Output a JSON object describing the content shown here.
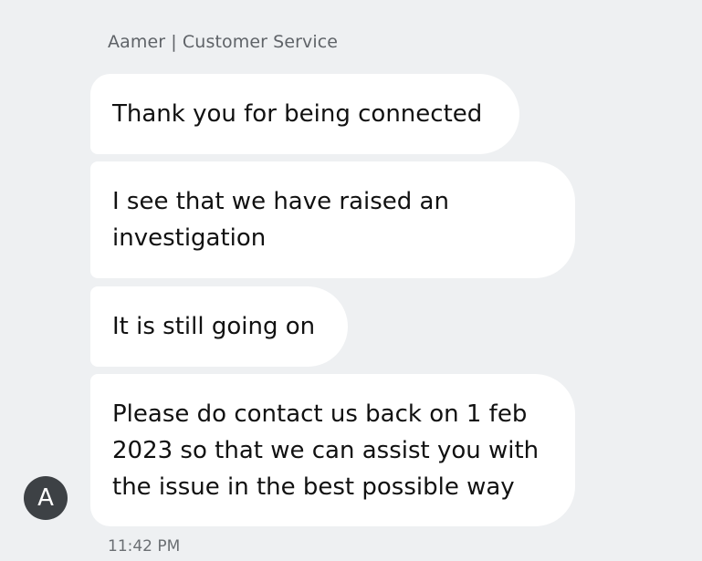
{
  "header": {
    "sender": "Aamer | Customer Service"
  },
  "messages": [
    {
      "text": "Thank you for being connected"
    },
    {
      "text": "I see that we have raised an\ninvestigation"
    },
    {
      "text": "It is still going on"
    },
    {
      "text": "Please do contact us back on 1 feb\n2023 so that we can assist you with\nthe issue in the best possible way"
    }
  ],
  "avatar": {
    "initial": "A"
  },
  "footer": {
    "timestamp": "11:42 PM"
  },
  "colors": {
    "background": "#eef0f2",
    "bubble": "#ffffff",
    "avatar": "#3d4145"
  }
}
